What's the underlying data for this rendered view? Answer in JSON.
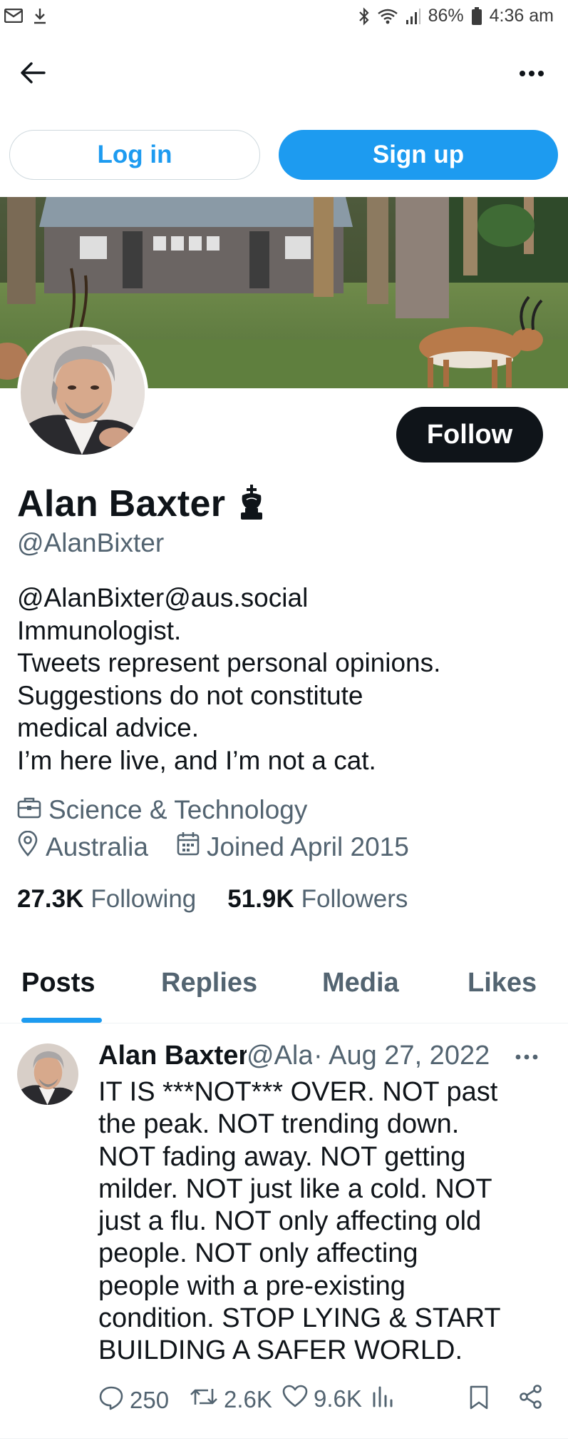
{
  "status_bar": {
    "battery": "86%",
    "time": "4:36 am"
  },
  "auth": {
    "login_label": "Log in",
    "signup_label": "Sign up"
  },
  "profile": {
    "name": "Alan Baxter",
    "badge_icon": "chess-king-icon",
    "handle": "@AlanBixter",
    "follow_label": "Follow",
    "bio_lines": [
      "@AlanBixter@aus.social",
      "Immunologist.",
      "Tweets represent personal opinions.",
      "Suggestions do not constitute",
      "medical advice.",
      "I’m here live, and I’m not a cat."
    ],
    "category": "Science & Technology",
    "location": "Australia",
    "joined": "Joined April 2015",
    "following_count": "27.3K",
    "following_label": "Following",
    "followers_count": "51.9K",
    "followers_label": "Followers"
  },
  "tabs": [
    {
      "label": "Posts",
      "active": true
    },
    {
      "label": "Replies",
      "active": false
    },
    {
      "label": "Media",
      "active": false
    },
    {
      "label": "Likes",
      "active": false
    }
  ],
  "post": {
    "author_name": "Alan Baxter",
    "author_handle": "@AlanBixter",
    "separator": "·",
    "date": "Aug 27, 2022",
    "text_lines": [
      "IT IS ***NOT*** OVER. NOT past",
      "the peak. NOT trending down.",
      "NOT fading away. NOT getting",
      "milder. NOT just like a cold. NOT",
      "just a flu. NOT only affecting old",
      "people. NOT only affecting",
      "people with a pre-existing",
      "condition. STOP LYING & START",
      "BUILDING A SAFER WORLD."
    ],
    "replies": "250",
    "reposts": "2.6K",
    "likes": "9.6K"
  },
  "colors": {
    "accent": "#1d9bf0",
    "text_primary": "#0f1419",
    "text_secondary": "#536471",
    "follow_bg": "#0f1419"
  }
}
